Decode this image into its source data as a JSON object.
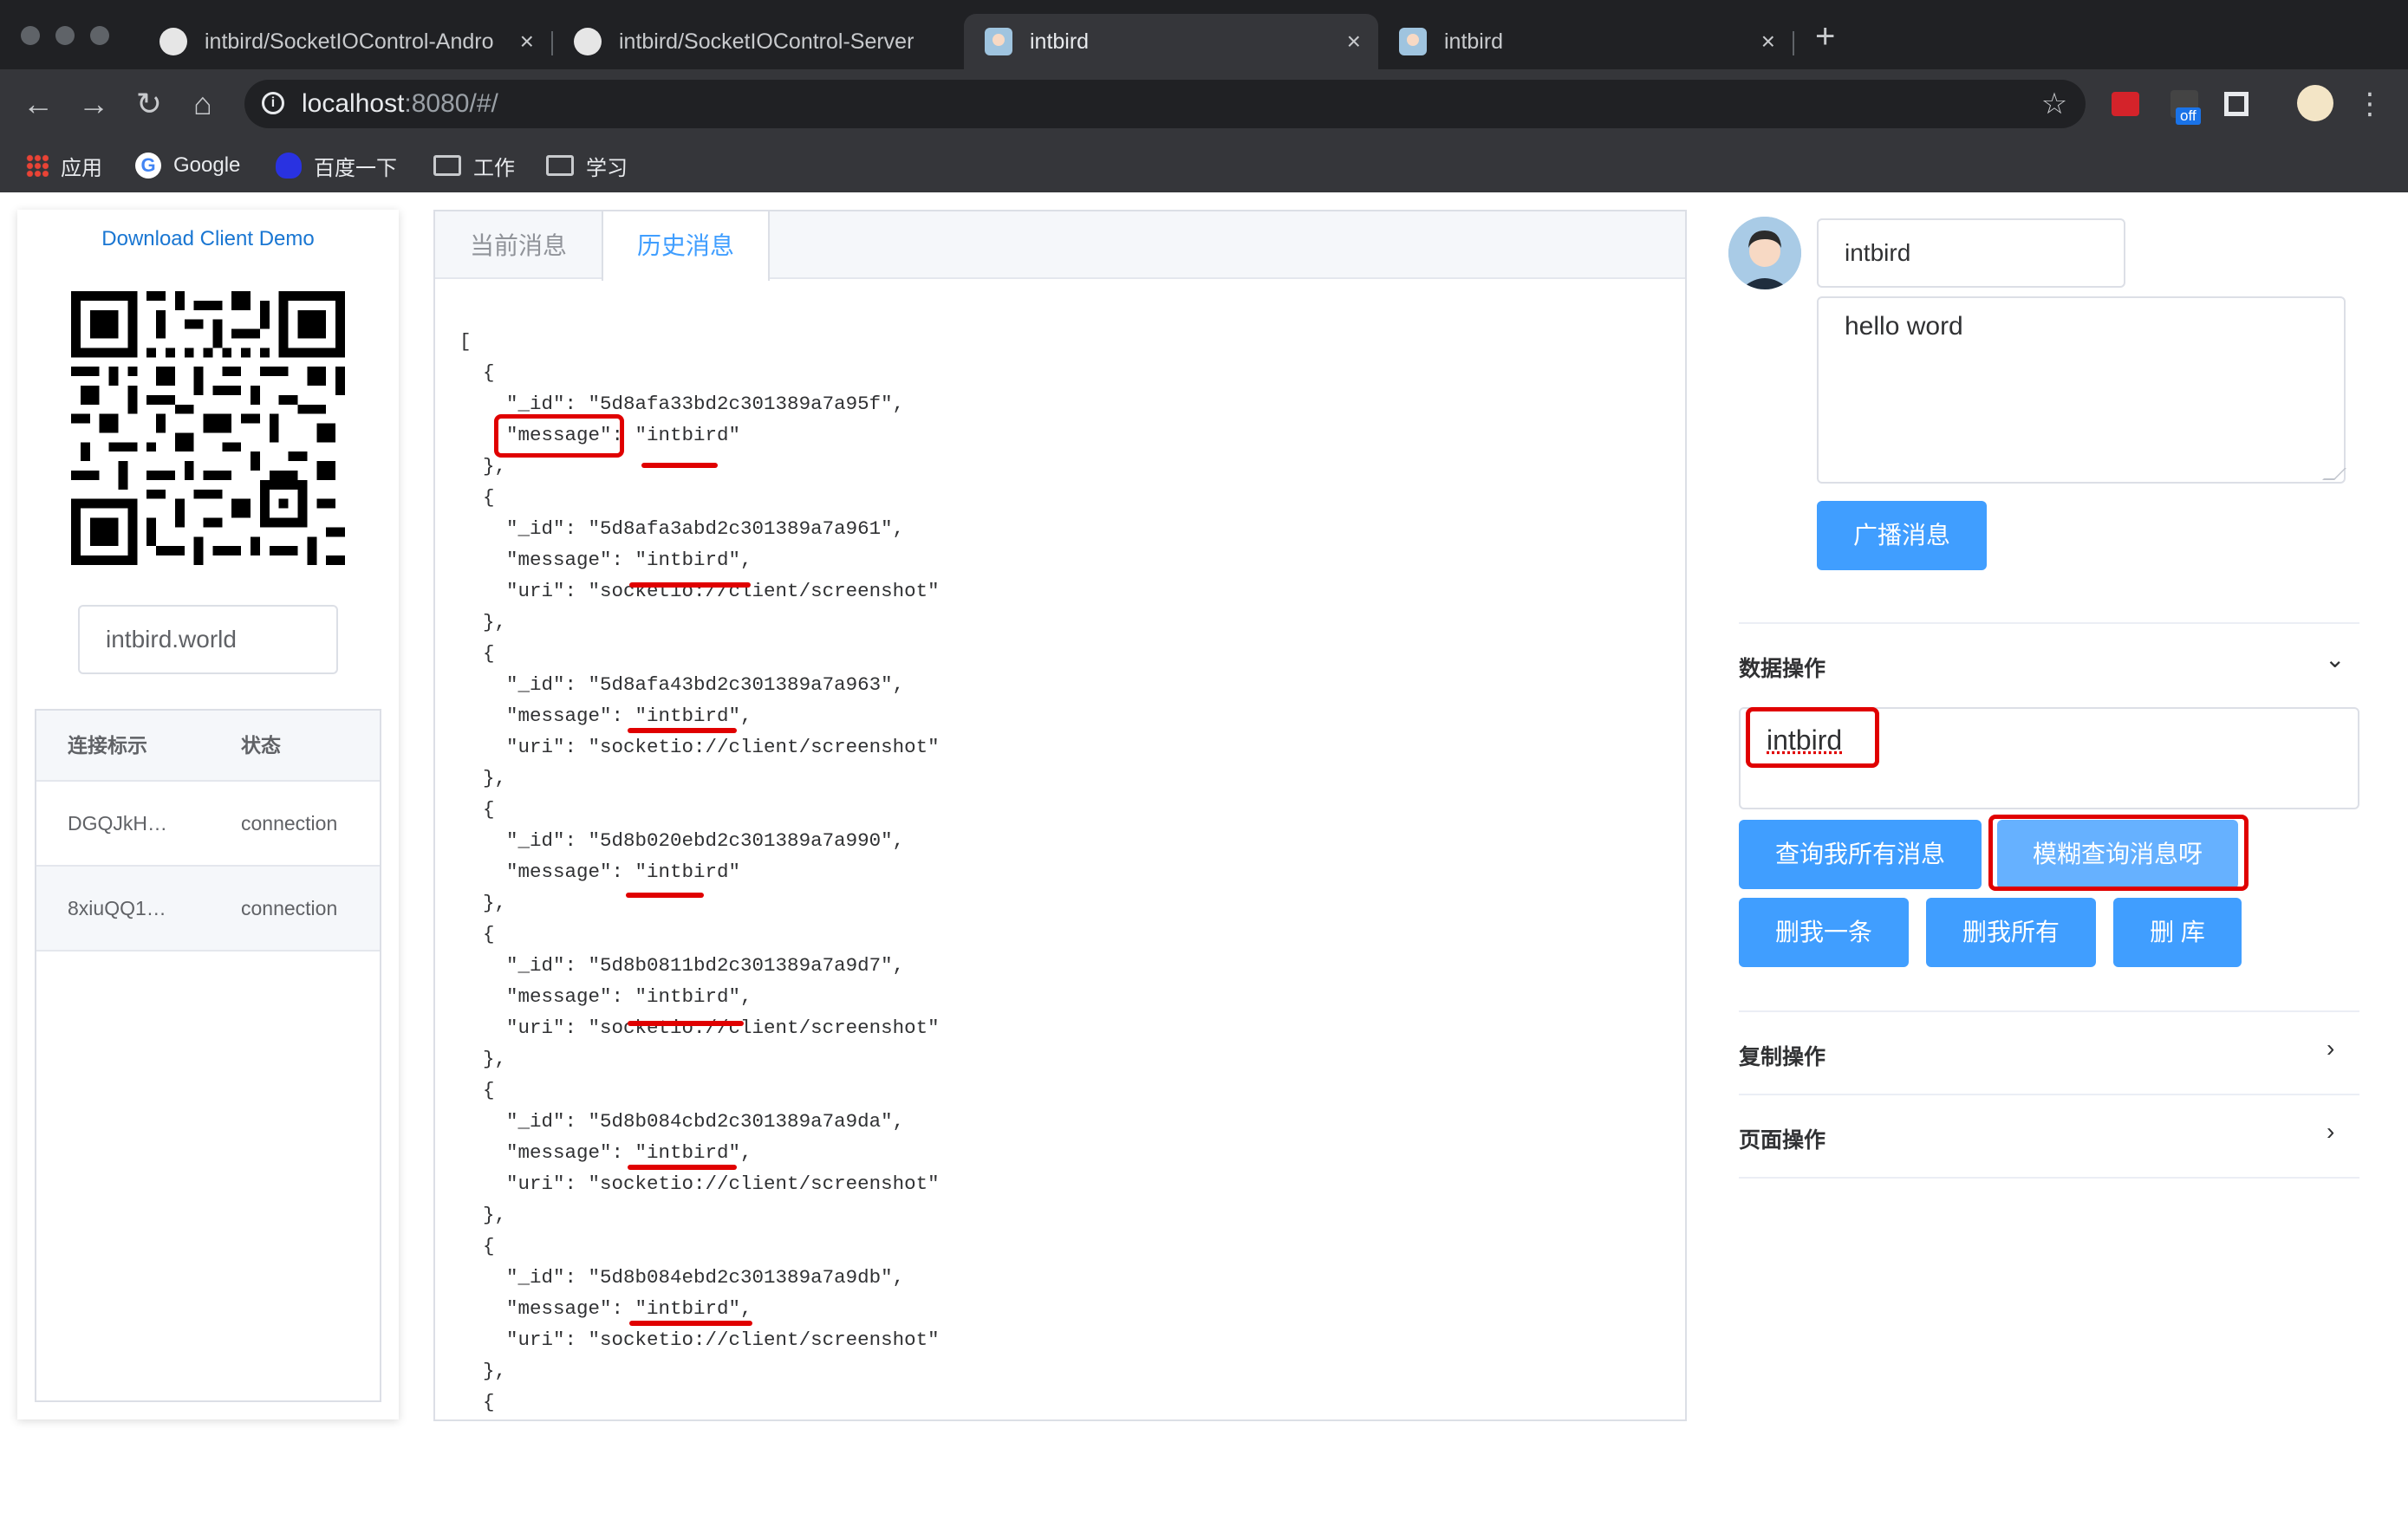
{
  "browser": {
    "tabs": [
      {
        "label": "intbird/SocketIOControl-Andro",
        "icon": "github-icon"
      },
      {
        "label": "intbird/SocketIOControl-Server",
        "icon": "github-icon"
      },
      {
        "label": "intbird",
        "icon": "avatar-favicon",
        "active": true
      },
      {
        "label": "intbird",
        "icon": "avatar-favicon"
      }
    ],
    "new_tab": "+",
    "close_glyph": "×",
    "url": {
      "host": "localhost",
      "rest": ":8080/#/"
    },
    "bookmarks": [
      {
        "label": "应用",
        "icon": "apps-grid-icon"
      },
      {
        "label": "Google",
        "icon": "google-icon"
      },
      {
        "label": "百度一下",
        "icon": "baidu-icon"
      },
      {
        "label": "工作",
        "icon": "folder-icon"
      },
      {
        "label": "学习",
        "icon": "folder-icon"
      }
    ],
    "extension_badge": "off"
  },
  "left": {
    "download_link": "Download Client Demo",
    "domain_value": "intbird.world",
    "table": {
      "headers": [
        "连接标示",
        "状态"
      ],
      "rows": [
        [
          "DGQJkH…",
          "connection"
        ],
        [
          "8xiuQQ1…",
          "connection"
        ]
      ]
    }
  },
  "middle": {
    "tabs": [
      "当前消息",
      "历史消息"
    ],
    "active_tab": "历史消息",
    "json_lines": [
      "[",
      "  {",
      "    \"_id\": \"5d8afa33bd2c301389a7a95f\",",
      "    \"message\": \"intbird\"",
      "  },",
      "  {",
      "    \"_id\": \"5d8afa3abd2c301389a7a961\",",
      "    \"message\": \"intbird\",",
      "    \"uri\": \"socketio://client/screenshot\"",
      "  },",
      "  {",
      "    \"_id\": \"5d8afa43bd2c301389a7a963\",",
      "    \"message\": \"intbird\",",
      "    \"uri\": \"socketio://client/screenshot\"",
      "  },",
      "  {",
      "    \"_id\": \"5d8b020ebd2c301389a7a990\",",
      "    \"message\": \"intbird\"",
      "  },",
      "  {",
      "    \"_id\": \"5d8b0811bd2c301389a7a9d7\",",
      "    \"message\": \"intbird\",",
      "    \"uri\": \"socketio://client/screenshot\"",
      "  },",
      "  {",
      "    \"_id\": \"5d8b084cbd2c301389a7a9da\",",
      "    \"message\": \"intbird\",",
      "    \"uri\": \"socketio://client/screenshot\"",
      "  },",
      "  {",
      "    \"_id\": \"5d8b084ebd2c301389a7a9db\",",
      "    \"message\": \"intbird\",",
      "    \"uri\": \"socketio://client/screenshot\"",
      "  },",
      "  {"
    ]
  },
  "right": {
    "name_value": "intbird",
    "message_value": "hello word",
    "broadcast_button": "广播消息",
    "sections": {
      "data_ops": "数据操作",
      "copy_ops": "复制操作",
      "page_ops": "页面操作"
    },
    "query_value": "intbird",
    "buttons": {
      "query_all": "查询我所有消息",
      "fuzzy_query": "模糊查询消息呀",
      "delete_one": "删我一条",
      "delete_all": "删我所有",
      "delete_db": "删 库"
    },
    "colors": {
      "primary": "#409eff",
      "highlight": "#e00000"
    }
  }
}
